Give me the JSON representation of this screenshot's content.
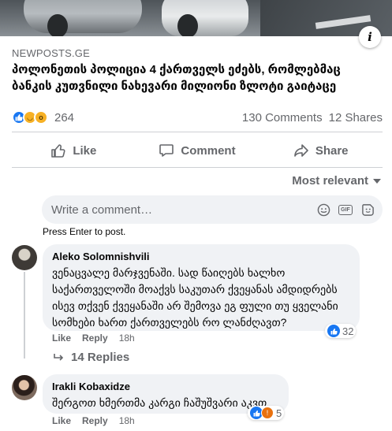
{
  "post": {
    "source": "NEWPOSTS.GE",
    "headline": "პოლონეთის პოლიცია 4 ქართველს ეძებს, რომლებმაც ბანკის კუთვნილი ნახევარი მილიონი ზლოტი გაიტაცე"
  },
  "stats": {
    "reaction_count": "264",
    "comments": "130 Comments",
    "shares": "12 Shares",
    "reaction_icons": [
      "like-icon",
      "haha-icon",
      "wow-icon"
    ]
  },
  "actions": {
    "like": "Like",
    "comment": "Comment",
    "share": "Share"
  },
  "sort": {
    "label": "Most relevant"
  },
  "composer": {
    "placeholder": "Write a comment…",
    "hint": "Press Enter to post.",
    "gif_label": "GIF"
  },
  "comments": [
    {
      "author": "Aleko Solomnishvili",
      "text": "ვენაცვალე მარჯვენაში. სად წაიღებს ხალხო საქართველოში მოაქვს საკუთარ ქვეყანას ამდიდრებს ისევ თქვენ ქვეყანაში არ შემოვა ეგ ფული თუ ყველანი სომხები ხართ ქართველებს რო ლანძღავთ?",
      "reactions": "32",
      "like": "Like",
      "reply": "Reply",
      "time": "18h",
      "replies": "14 Replies"
    },
    {
      "author": "Irakli Kobaxidze",
      "text": "შერგოთ ხმერთმა კარგი ჩაშუშვარი აკვთ",
      "reactions": "5",
      "like": "Like",
      "reply": "Reply",
      "time": "18h"
    }
  ],
  "colors": {
    "brand_blue": "#1877f2",
    "secondary_text": "#65676b",
    "bubble_bg": "#f0f2f5"
  }
}
